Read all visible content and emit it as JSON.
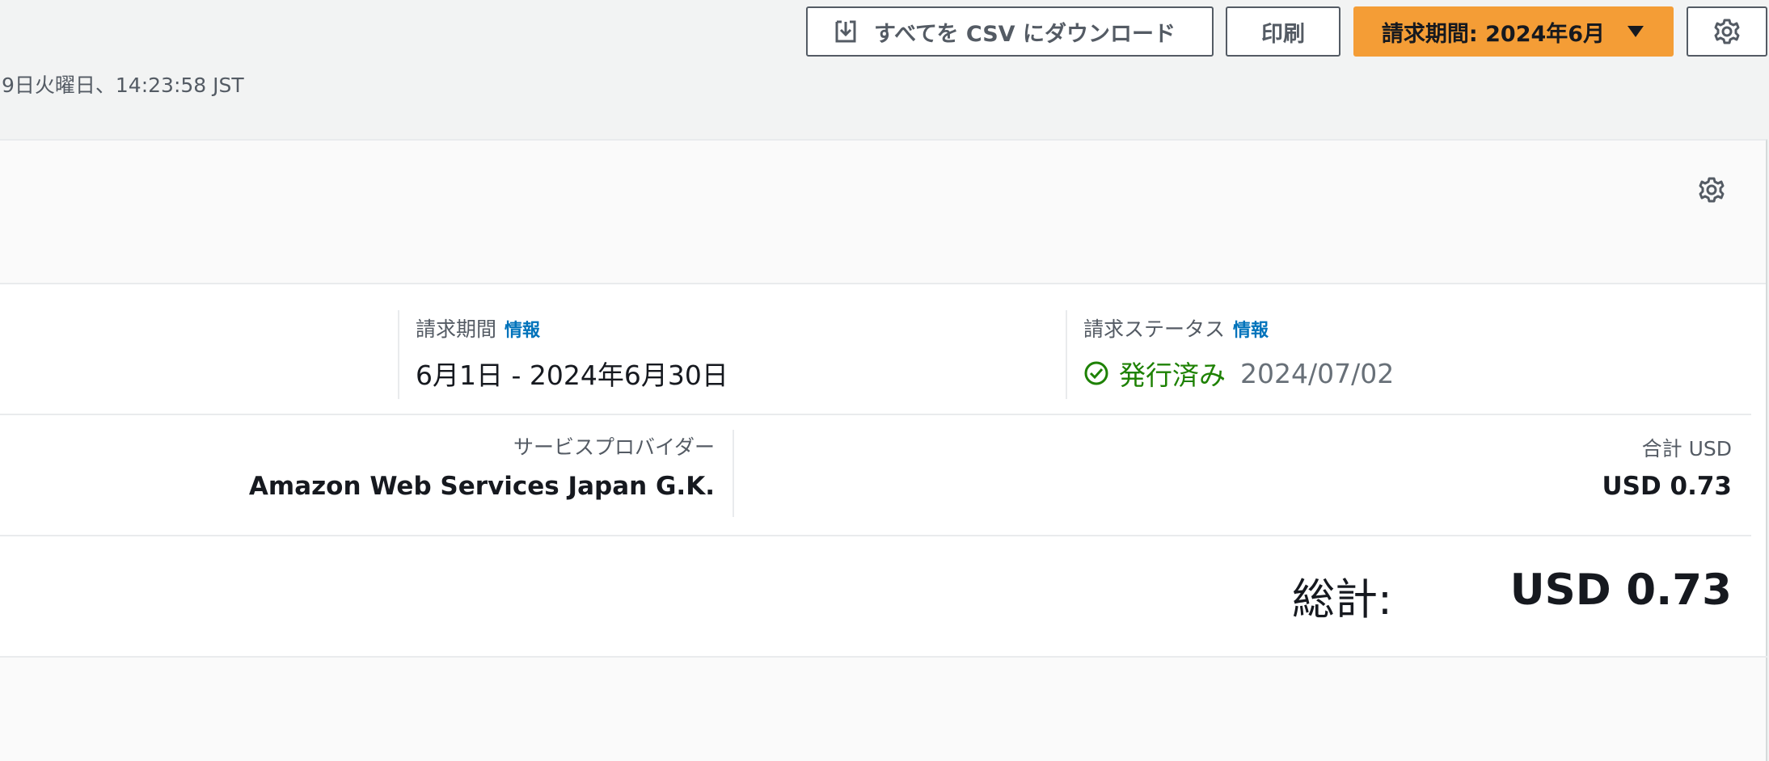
{
  "toolbar": {
    "csv_label": "すべてを CSV にダウンロード",
    "csv_icon": "download-icon",
    "print_label": "印刷",
    "period_label": "請求期間: 2024年6月",
    "period_icon": "caret-down-icon",
    "settings_icon": "gear-icon",
    "accent_color": "#f49d36"
  },
  "timestamp": "9日火曜日、14:23:58 JST",
  "summary": {
    "settings_icon": "gear-icon",
    "billing_period": {
      "label": "請求期間",
      "info": "情報",
      "value": "6月1日 - 2024年6月30日"
    },
    "billing_status": {
      "label": "請求ステータス",
      "info": "情報",
      "status_icon": "check-circle-icon",
      "status": "発行済み",
      "date": "2024/07/02",
      "status_color": "#1d8102"
    },
    "provider": {
      "label": "サービスプロバイダー",
      "value": "Amazon Web Services Japan G.K."
    },
    "total": {
      "label": "合計 USD",
      "value": "USD 0.73"
    },
    "grand_total": {
      "label": "総計:",
      "value": "USD 0.73"
    }
  }
}
